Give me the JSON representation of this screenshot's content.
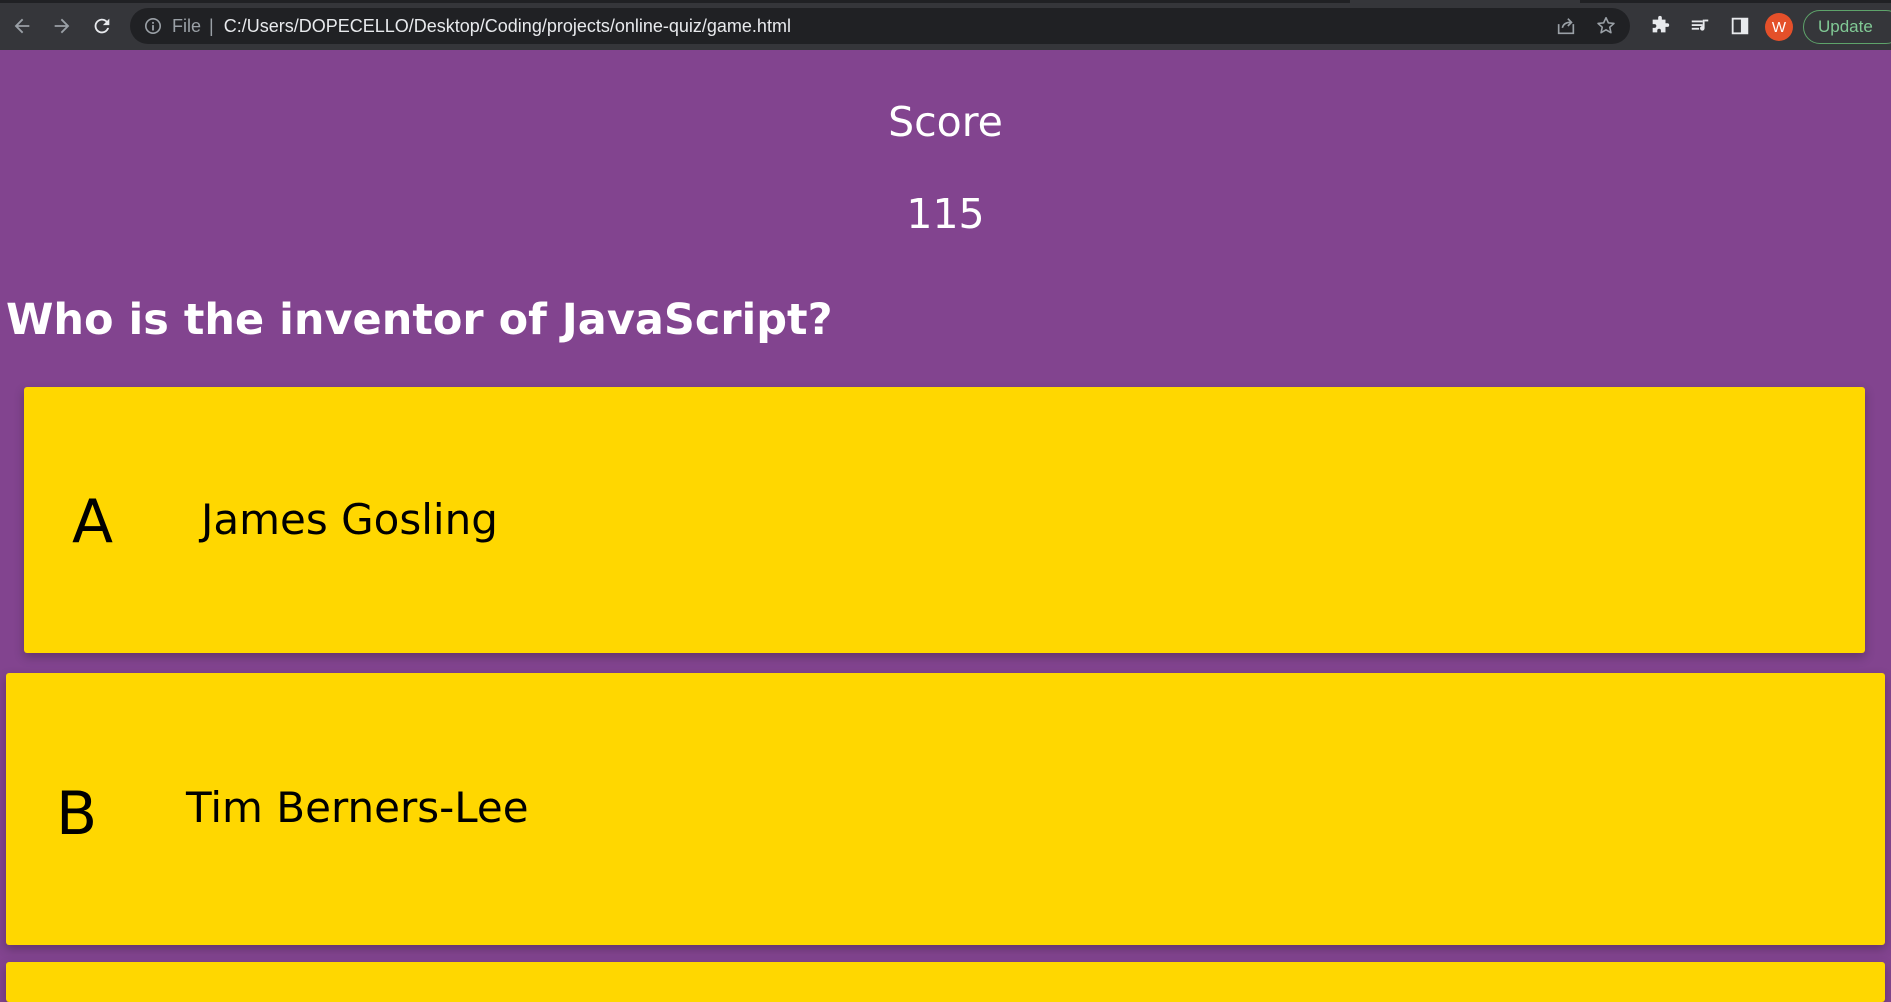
{
  "browser": {
    "url_scheme": "File",
    "url": "C:/Users/DOPECELLO/Desktop/Coding/projects/online-quiz/game.html",
    "profile_initial": "W",
    "update_label": "Update"
  },
  "hud": {
    "score_label": "Score",
    "score_value": "115"
  },
  "question": {
    "text": "Who is the inventor of JavaScript?"
  },
  "choices": [
    {
      "prefix": "A",
      "text": "James Gosling"
    },
    {
      "prefix": "B",
      "text": "Tim Berners-Lee"
    }
  ],
  "colors": {
    "background": "#82448f",
    "choice": "#ffd700",
    "chrome": "#35363a"
  }
}
